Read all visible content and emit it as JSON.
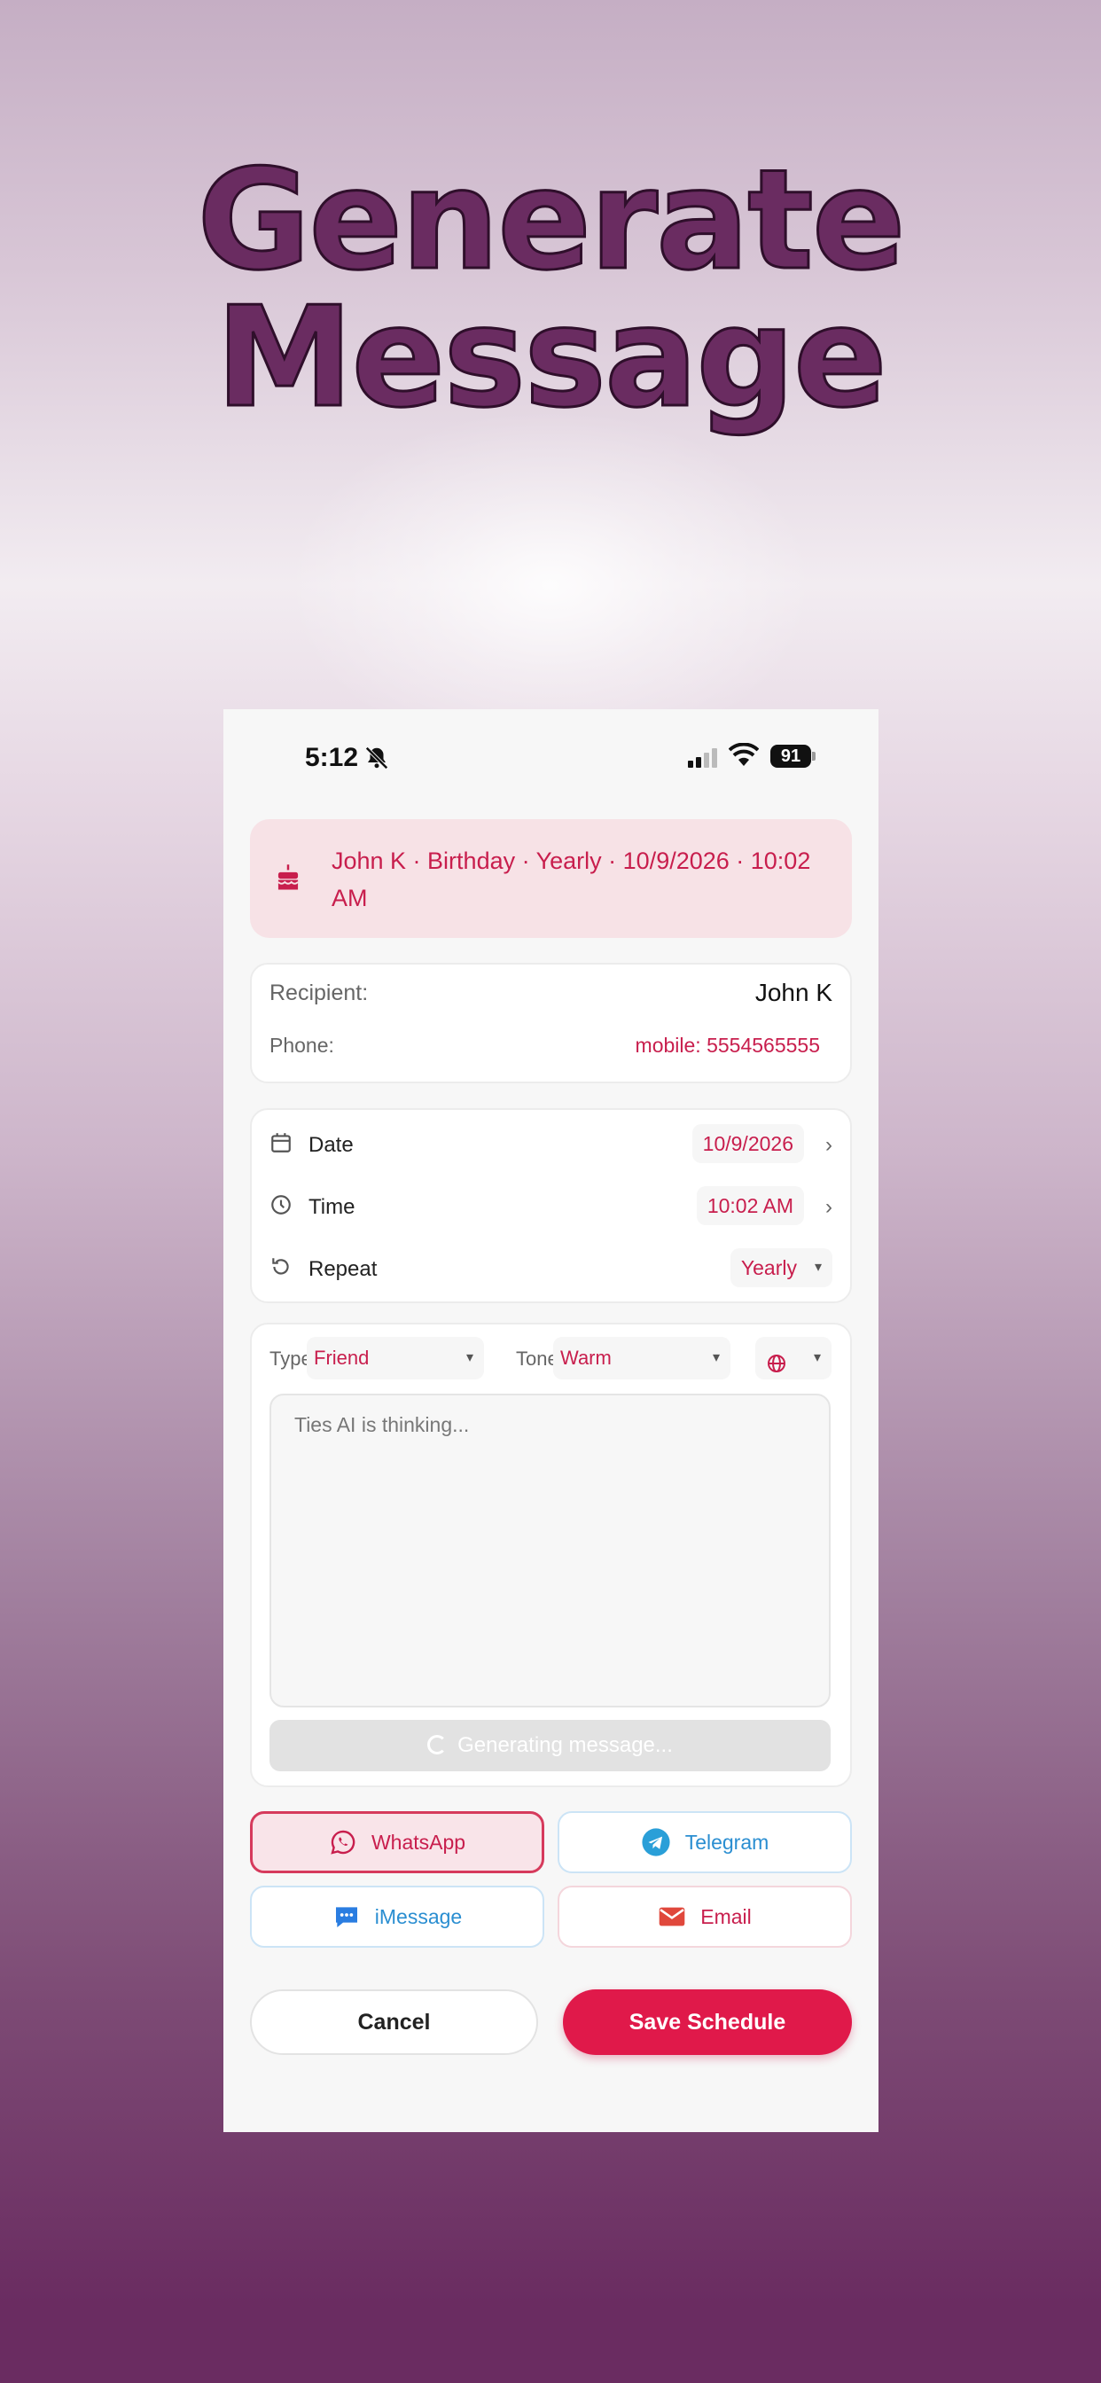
{
  "headline": {
    "line1": "Generate",
    "line2": "Message"
  },
  "status_bar": {
    "time": "5:12",
    "battery": "91"
  },
  "banner": {
    "text": "John K · Birthday · Yearly · 10/9/2026 · 10:02 AM",
    "icon": "birthday-cake-icon"
  },
  "recipient": {
    "label": "Recipient:",
    "name": "John K",
    "phone_label": "Phone:",
    "phone_value": "mobile: 5554565555"
  },
  "schedule": {
    "date": {
      "label": "Date",
      "value": "10/9/2026"
    },
    "time": {
      "label": "Time",
      "value": "10:02 AM"
    },
    "repeat": {
      "label": "Repeat",
      "value": "Yearly"
    }
  },
  "message": {
    "type_label": "Type:",
    "type_value": "Friend",
    "tone_label": "Tone:",
    "tone_value": "Warm",
    "placeholder": "Ties AI is thinking...",
    "generate_button": "Generating message..."
  },
  "channels": {
    "whatsapp": "WhatsApp",
    "telegram": "Telegram",
    "imessage": "iMessage",
    "email": "Email"
  },
  "actions": {
    "cancel": "Cancel",
    "save": "Save Schedule"
  },
  "colors": {
    "accent": "#e0194a",
    "accent_text": "#c81e4d",
    "brand_purple": "#6a2c61",
    "link_blue": "#2a8ed1"
  }
}
